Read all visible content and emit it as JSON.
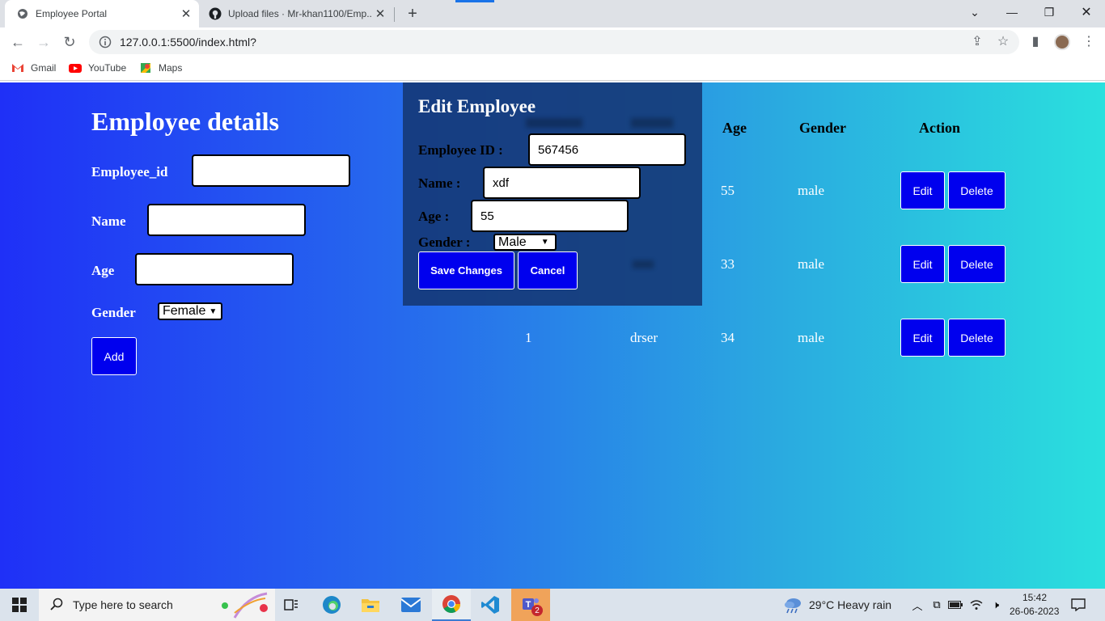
{
  "browser": {
    "tabs": [
      {
        "title": "Employee Portal",
        "icon": "globe-icon",
        "active": true
      },
      {
        "title": "Upload files · Mr-khan1100/Emp...",
        "icon": "github-icon",
        "active": false
      }
    ],
    "url": "127.0.0.1:5500/index.html?",
    "bookmarks": [
      {
        "label": "Gmail",
        "icon": "gmail-icon"
      },
      {
        "label": "YouTube",
        "icon": "youtube-icon"
      },
      {
        "label": "Maps",
        "icon": "maps-icon"
      }
    ]
  },
  "form": {
    "title": "Employee details",
    "employee_id_label": "Employee_id",
    "name_label": "Name",
    "age_label": "Age",
    "gender_label": "Gender",
    "gender_value": "Female",
    "add_label": "Add"
  },
  "table": {
    "headers": {
      "age": "Age",
      "gender": "Gender",
      "action": "Action"
    },
    "rows": [
      {
        "id": "",
        "name": "",
        "age": "55",
        "gender": "male"
      },
      {
        "id": "",
        "name": "",
        "age": "33",
        "gender": "male"
      },
      {
        "id": "1",
        "name": "drser",
        "age": "34",
        "gender": "male"
      }
    ],
    "edit_label": "Edit",
    "delete_label": "Delete"
  },
  "modal": {
    "title": "Edit Employee",
    "employee_id_label": "Employee ID :",
    "employee_id_value": "567456",
    "name_label": "Name :",
    "name_value": "xdf",
    "age_label": "Age :",
    "age_value": "55",
    "gender_label": "Gender :",
    "gender_value": "Male",
    "save_label": "Save Changes",
    "cancel_label": "Cancel"
  },
  "taskbar": {
    "search_placeholder": "Type here to search",
    "weather": "29°C  Heavy rain",
    "time": "15:42",
    "date": "26-06-2023",
    "teams_badge": "2"
  },
  "colors": {
    "gradient_start": "#1f30f7",
    "gradient_end": "#2ae0de",
    "button_blue": "#0000ee",
    "modal_bg": "#143773"
  }
}
